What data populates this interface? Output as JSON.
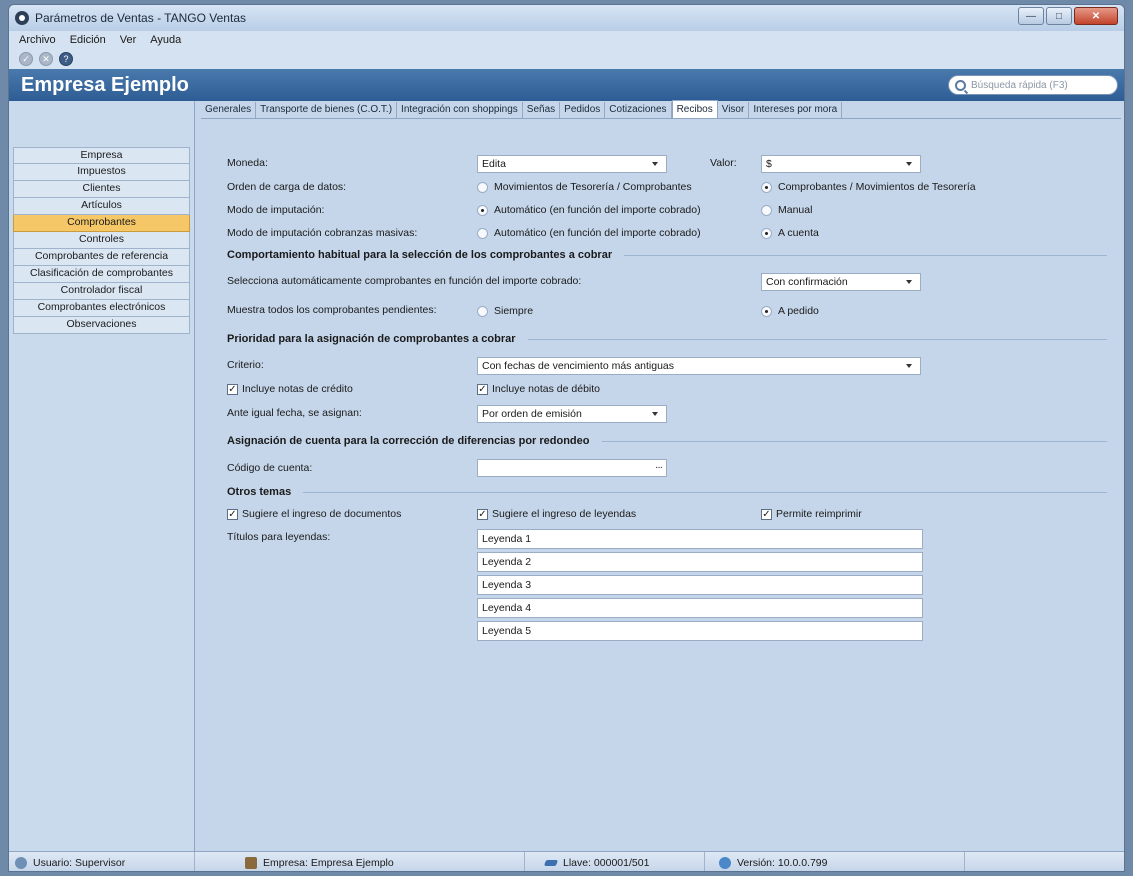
{
  "window": {
    "title": "Parámetros de Ventas - TANGO Ventas"
  },
  "menu": {
    "items": [
      "Archivo",
      "Edición",
      "Ver",
      "Ayuda"
    ]
  },
  "header": {
    "company": "Empresa Ejemplo",
    "search_placeholder": "Búsqueda rápida (F3)"
  },
  "sidebar": {
    "items": [
      {
        "label": "Empresa",
        "active": false
      },
      {
        "label": "Impuestos",
        "active": false
      },
      {
        "label": "Clientes",
        "active": false
      },
      {
        "label": "Artículos",
        "active": false
      },
      {
        "label": "Comprobantes",
        "active": true
      },
      {
        "label": "Controles",
        "active": false
      },
      {
        "label": "Comprobantes de referencia",
        "active": false
      },
      {
        "label": "Clasificación de comprobantes",
        "active": false
      },
      {
        "label": "Controlador fiscal",
        "active": false
      },
      {
        "label": "Comprobantes electrónicos",
        "active": false
      },
      {
        "label": "Observaciones",
        "active": false
      }
    ]
  },
  "tabs": [
    {
      "label": "Generales",
      "active": false
    },
    {
      "label": "Transporte de bienes (C.O.T.)",
      "active": false
    },
    {
      "label": "Integración con shoppings",
      "active": false
    },
    {
      "label": "Señas",
      "active": false
    },
    {
      "label": "Pedidos",
      "active": false
    },
    {
      "label": "Cotizaciones",
      "active": false
    },
    {
      "label": "Recibos",
      "active": true
    },
    {
      "label": "Visor",
      "active": false
    },
    {
      "label": "Intereses por mora",
      "active": false
    }
  ],
  "form": {
    "moneda": {
      "label": "Moneda:",
      "value": "Edita",
      "valor_label": "Valor:",
      "valor_value": "$"
    },
    "orden": {
      "label": "Orden de carga de datos:",
      "opt1": "Movimientos de Tesorería / Comprobantes",
      "opt2": "Comprobantes / Movimientos de Tesorería"
    },
    "modo": {
      "label": "Modo de imputación:",
      "opt1": "Automático (en función del importe cobrado)",
      "opt2": "Manual"
    },
    "modo_masivas": {
      "label": "Modo de imputación cobranzas masivas:",
      "opt1": "Automático (en función del importe cobrado)",
      "opt2": "A cuenta"
    },
    "section1": "Comportamiento habitual para la selección de los comprobantes a cobrar",
    "selecciona": {
      "label": "Selecciona automáticamente comprobantes en función del importe cobrado:",
      "value": "Con confirmación"
    },
    "muestra": {
      "label": "Muestra todos los comprobantes pendientes:",
      "opt1": "Siempre",
      "opt2": "A pedido"
    },
    "section2": "Prioridad para la asignación de comprobantes a cobrar",
    "criterio": {
      "label": "Criterio:",
      "value": "Con fechas de vencimiento más antiguas"
    },
    "notas_credito": "Incluye notas de crédito",
    "notas_debito": "Incluye notas de débito",
    "ante_igual": {
      "label": "Ante igual fecha, se asignan:",
      "value": "Por orden de emisión"
    },
    "section3": "Asignación de cuenta para la corrección de diferencias por redondeo",
    "codigo": {
      "label": "Código de cuenta:",
      "value": "",
      "ellipsis": "···"
    },
    "section4": "Otros temas",
    "sugiere_doc": "Sugiere el ingreso de documentos",
    "sugiere_ley": "Sugiere el ingreso de  leyendas",
    "permite": "Permite reimprimir",
    "titulos_label": "Títulos para leyendas:",
    "leyendas": [
      "Leyenda 1",
      "Leyenda 2",
      "Leyenda 3",
      "Leyenda 4",
      "Leyenda 5"
    ]
  },
  "status": {
    "usuario": "Usuario: Supervisor",
    "empresa": "Empresa: Empresa Ejemplo",
    "llave": "Llave: 000001/501",
    "version": "Versión: 10.0.0.799"
  }
}
